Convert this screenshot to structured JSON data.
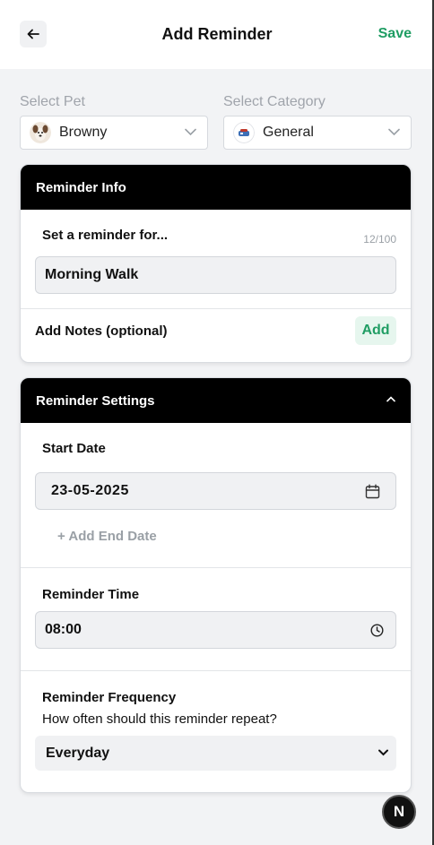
{
  "header": {
    "title": "Add Reminder",
    "save_label": "Save"
  },
  "pet_select": {
    "label": "Select Pet",
    "value": "Browny"
  },
  "category_select": {
    "label": "Select Category",
    "value": "General"
  },
  "reminder_info": {
    "title": "Reminder Info",
    "reminder_for_label": "Set a reminder for...",
    "char_count": "12/100",
    "reminder_for_value": "Morning Walk",
    "notes_label": "Add Notes (optional)",
    "add_label": "Add"
  },
  "reminder_settings": {
    "title": "Reminder Settings",
    "start_date_label": "Start Date",
    "start_date_value": "23-05-2025",
    "add_end_date_label": "+ Add End Date",
    "time_label": "Reminder Time",
    "time_value": "08:00",
    "frequency_label": "Reminder Frequency",
    "frequency_subtitle": "How often should this reminder repeat?",
    "frequency_value": "Everyday"
  },
  "fab": {
    "label": "N"
  },
  "colors": {
    "accent": "#1f9d63",
    "header_bg": "#000000",
    "page_bg": "#f2f3f5"
  }
}
